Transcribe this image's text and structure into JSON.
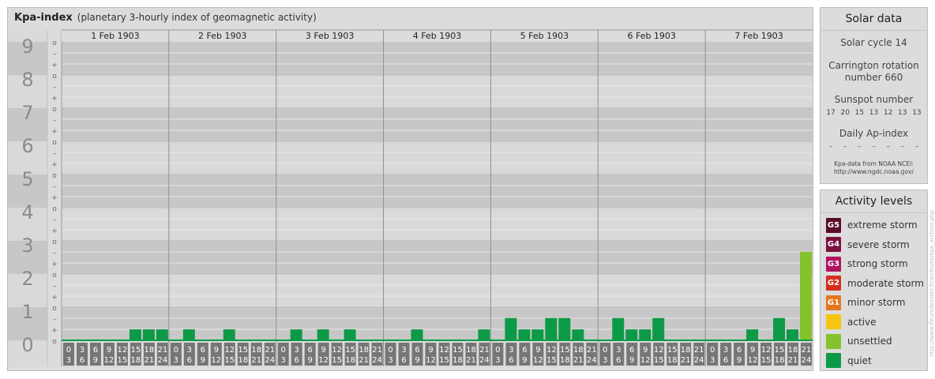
{
  "header": {
    "title": "Kpa-index",
    "subtitle": "(planetary 3-hourly index of geomagnetic activity)"
  },
  "chart_data": {
    "type": "bar",
    "title": "Kpa-index",
    "subtitle": "(planetary 3-hourly index of geomagnetic activity)",
    "ylim": [
      0,
      9
    ],
    "y_ticks": [
      "0",
      "1",
      "2",
      "3",
      "4",
      "5",
      "6",
      "7",
      "8",
      "9"
    ],
    "y_subticks": [
      "+",
      "o",
      "–"
    ],
    "days": [
      "1 Feb 1903",
      "2 Feb 1903",
      "3 Feb 1903",
      "4 Feb 1903",
      "5 Feb 1903",
      "6 Feb 1903",
      "7 Feb 1903"
    ],
    "intervals": [
      {
        "top": "0",
        "bottom": "3"
      },
      {
        "top": "3",
        "bottom": "6"
      },
      {
        "top": "6",
        "bottom": "9"
      },
      {
        "top": "9",
        "bottom": "12"
      },
      {
        "top": "12",
        "bottom": "15"
      },
      {
        "top": "15",
        "bottom": "18"
      },
      {
        "top": "18",
        "bottom": "21"
      },
      {
        "top": "21",
        "bottom": "24"
      }
    ],
    "values": [
      0.0,
      0.0,
      0.0,
      0.0,
      0.0,
      0.33,
      0.33,
      0.33,
      0.0,
      0.33,
      0.0,
      0.0,
      0.33,
      0.0,
      0.0,
      0.0,
      0.0,
      0.33,
      0.0,
      0.33,
      0.0,
      0.33,
      0.0,
      0.0,
      0.0,
      0.0,
      0.33,
      0.0,
      0.0,
      0.0,
      0.0,
      0.33,
      0.0,
      0.67,
      0.33,
      0.33,
      0.67,
      0.67,
      0.33,
      0.0,
      0.0,
      0.67,
      0.33,
      0.33,
      0.67,
      0.0,
      0.0,
      0.0,
      0.0,
      0.0,
      0.0,
      0.33,
      0.0,
      0.67,
      0.33,
      2.67
    ],
    "bar_colors": {
      "quiet": "#0d9a47",
      "unsettled": "#84c22c"
    },
    "grid": true
  },
  "solar": {
    "title": "Solar data",
    "cycle_text": "Solar cycle 14",
    "carrington_line1": "Carrington rotation",
    "carrington_line2": "number 660",
    "sunspot_label": "Sunspot number",
    "sunspot_values": [
      "17",
      "20",
      "15",
      "13",
      "12",
      "13",
      "13"
    ],
    "ap_label": "Daily Ap-index",
    "ap_values": [
      "–",
      "–",
      "–",
      "–",
      "–",
      "–",
      "–"
    ],
    "source_line1": "Kpa-data from NOAA NCEI:",
    "source_line2": "http://www.ngdc.noaa.gov/"
  },
  "activity": {
    "title": "Activity levels",
    "levels": [
      {
        "badge": "G5",
        "label": "extreme storm",
        "color": "#5a0a2a"
      },
      {
        "badge": "G4",
        "label": "severe storm",
        "color": "#7d0f3f"
      },
      {
        "badge": "G3",
        "label": "strong storm",
        "color": "#b0125f"
      },
      {
        "badge": "G2",
        "label": "moderate storm",
        "color": "#d42f1f"
      },
      {
        "badge": "G1",
        "label": "minor storm",
        "color": "#e6761d"
      },
      {
        "badge": "",
        "label": "active",
        "color": "#f7c511"
      },
      {
        "badge": "",
        "label": "unsettled",
        "color": "#84c22c"
      },
      {
        "badge": "",
        "label": "quiet",
        "color": "#0d9a47"
      }
    ]
  },
  "watermark": "http://www.fleursdesoleil.fr/archives/kpa_archive.php"
}
